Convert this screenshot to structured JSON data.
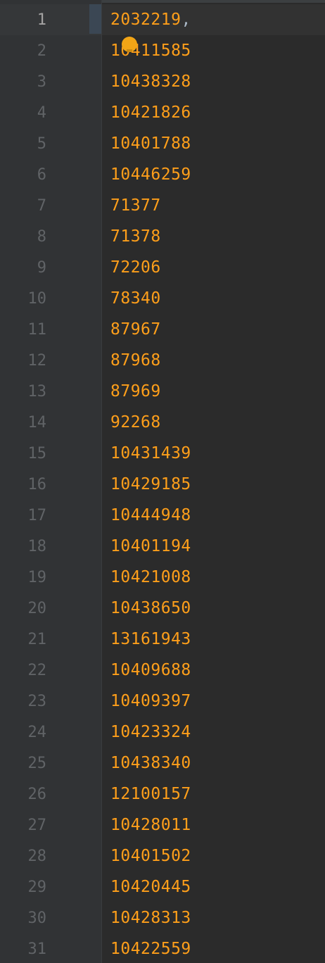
{
  "editor": {
    "lines": [
      {
        "number": "1",
        "code": "2032219",
        "suffix": ","
      },
      {
        "number": "2",
        "code": "10411585",
        "suffix": ""
      },
      {
        "number": "3",
        "code": "10438328",
        "suffix": ""
      },
      {
        "number": "4",
        "code": "10421826",
        "suffix": ""
      },
      {
        "number": "5",
        "code": "10401788",
        "suffix": ""
      },
      {
        "number": "6",
        "code": "10446259",
        "suffix": ""
      },
      {
        "number": "7",
        "code": "71377",
        "suffix": ""
      },
      {
        "number": "8",
        "code": "71378",
        "suffix": ""
      },
      {
        "number": "9",
        "code": "72206",
        "suffix": ""
      },
      {
        "number": "10",
        "code": "78340",
        "suffix": ""
      },
      {
        "number": "11",
        "code": "87967",
        "suffix": ""
      },
      {
        "number": "12",
        "code": "87968",
        "suffix": ""
      },
      {
        "number": "13",
        "code": "87969",
        "suffix": ""
      },
      {
        "number": "14",
        "code": "92268",
        "suffix": ""
      },
      {
        "number": "15",
        "code": "10431439",
        "suffix": ""
      },
      {
        "number": "16",
        "code": "10429185",
        "suffix": ""
      },
      {
        "number": "17",
        "code": "10444948",
        "suffix": ""
      },
      {
        "number": "18",
        "code": "10401194",
        "suffix": ""
      },
      {
        "number": "19",
        "code": "10421008",
        "suffix": ""
      },
      {
        "number": "20",
        "code": "10438650",
        "suffix": ""
      },
      {
        "number": "21",
        "code": "13161943",
        "suffix": ""
      },
      {
        "number": "22",
        "code": "10409688",
        "suffix": ""
      },
      {
        "number": "23",
        "code": "10409397",
        "suffix": ""
      },
      {
        "number": "24",
        "code": "10423324",
        "suffix": ""
      },
      {
        "number": "25",
        "code": "10438340",
        "suffix": ""
      },
      {
        "number": "26",
        "code": "12100157",
        "suffix": ""
      },
      {
        "number": "27",
        "code": "10428011",
        "suffix": ""
      },
      {
        "number": "28",
        "code": "10401502",
        "suffix": ""
      },
      {
        "number": "29",
        "code": "10420445",
        "suffix": ""
      },
      {
        "number": "30",
        "code": "10428313",
        "suffix": ""
      },
      {
        "number": "31",
        "code": "10422559",
        "suffix": ""
      }
    ],
    "active_line": 1,
    "intention_icon": "lightbulb-icon",
    "colors": {
      "background": "#2b2b2b",
      "gutter": "#313335",
      "number_literal": "#ff9f1a",
      "line_number": "#606366",
      "active_line_number": "#a4a3a3",
      "comma": "#a9b7c6",
      "bulb": "#f2a516"
    }
  }
}
